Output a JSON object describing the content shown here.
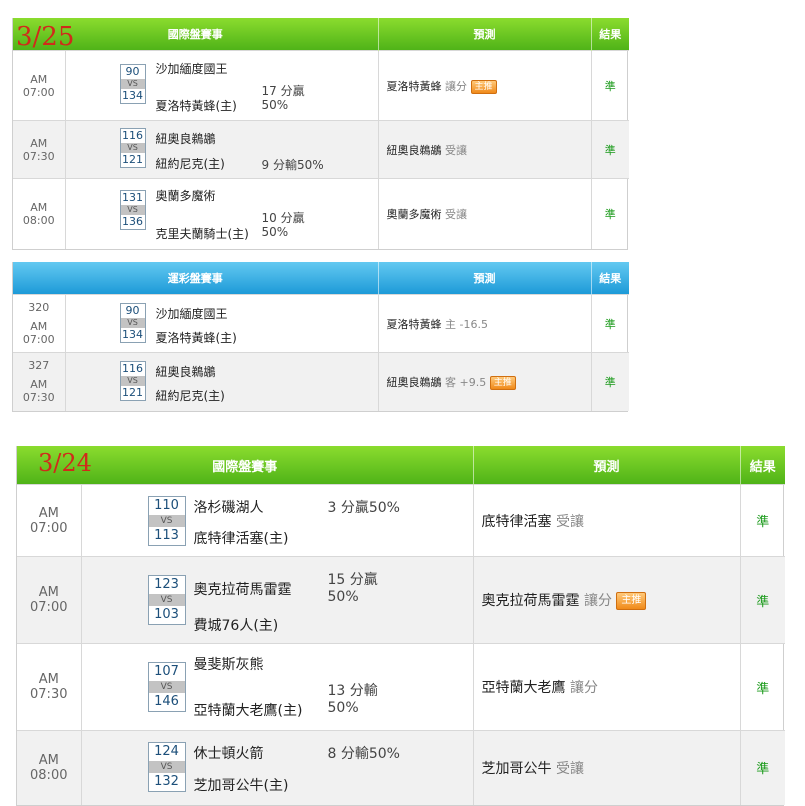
{
  "dates": {
    "d1": "3/25",
    "d2": "3/24"
  },
  "t1": {
    "headers": [
      "國際盤賽事",
      "預測",
      "結果"
    ],
    "rows": [
      {
        "time": "AM 07:00",
        "away_no": "90",
        "vs": "VS",
        "home_no": "134",
        "away": "沙加緬度國王",
        "home": "夏洛特黃蜂(主)",
        "hc1": "17 分贏",
        "hc2": "50%",
        "pick": "夏洛特黃蜂",
        "note": "讓分",
        "tag": "主推",
        "result": "準"
      },
      {
        "time": "AM 07:30",
        "away_no": "116",
        "vs": "VS",
        "home_no": "121",
        "away": "紐奧良鵜鶘",
        "home": "紐約尼克(主)",
        "hc1": "9 分輸50%",
        "hc2": "",
        "pick": "紐奧良鵜鶘",
        "note": "受讓",
        "tag": "",
        "result": "準"
      },
      {
        "time": "AM 08:00",
        "away_no": "131",
        "vs": "VS",
        "home_no": "136",
        "away": "奧蘭多魔術",
        "home": "克里夫蘭騎士(主)",
        "hc1": "10 分贏",
        "hc2": "50%",
        "pick": "奧蘭多魔術",
        "note": "受讓",
        "tag": "",
        "result": "準"
      }
    ]
  },
  "t2": {
    "headers": [
      "運彩盤賽事",
      "預測",
      "結果"
    ],
    "rows": [
      {
        "num": "320",
        "time": "AM 07:00",
        "away_no": "90",
        "vs": "VS",
        "home_no": "134",
        "away": "沙加緬度國王",
        "home": "夏洛特黃蜂(主)",
        "pick": "夏洛特黃蜂",
        "note": "主 -16.5",
        "tag": "",
        "result": "準"
      },
      {
        "num": "327",
        "time": "AM 07:30",
        "away_no": "116",
        "vs": "VS",
        "home_no": "121",
        "away": "紐奧良鵜鶘",
        "home": "紐約尼克(主)",
        "pick": "紐奧良鵜鶘",
        "note": "客 +9.5",
        "tag": "主推",
        "result": "準"
      }
    ]
  },
  "t3": {
    "headers": [
      "國際盤賽事",
      "預測",
      "結果"
    ],
    "rows": [
      {
        "time": "AM 07:00",
        "away_no": "110",
        "vs": "VS",
        "home_no": "113",
        "away": "洛杉磯湖人",
        "home": "底特律活塞(主)",
        "hc1": "3 分贏50%",
        "hc2": "",
        "pick": "底特律活塞",
        "note": "受讓",
        "tag": "",
        "result": "準"
      },
      {
        "time": "AM 07:00",
        "away_no": "123",
        "vs": "VS",
        "home_no": "103",
        "away": "奧克拉荷馬雷霆",
        "home": "費城76人(主)",
        "hc1": "15 分贏",
        "hc2": "50%",
        "pick": "奧克拉荷馬雷霆",
        "note": "讓分",
        "tag": "主推",
        "result": "準"
      },
      {
        "time": "AM 07:30",
        "away_no": "107",
        "vs": "VS",
        "home_no": "146",
        "away": "曼斐斯灰熊",
        "home": "亞特蘭大老鷹(主)",
        "hc1": "13 分輸",
        "hc2": "50%",
        "pick": "亞特蘭大老鷹",
        "note": "讓分",
        "tag": "",
        "result": "準"
      },
      {
        "time": "AM 08:00",
        "away_no": "124",
        "vs": "VS",
        "home_no": "132",
        "away": "休士頓火箭",
        "home": "芝加哥公牛(主)",
        "hc1": "8 分輸50%",
        "hc2": "",
        "pick": "芝加哥公牛",
        "note": "受讓",
        "tag": "",
        "result": "準"
      }
    ]
  }
}
